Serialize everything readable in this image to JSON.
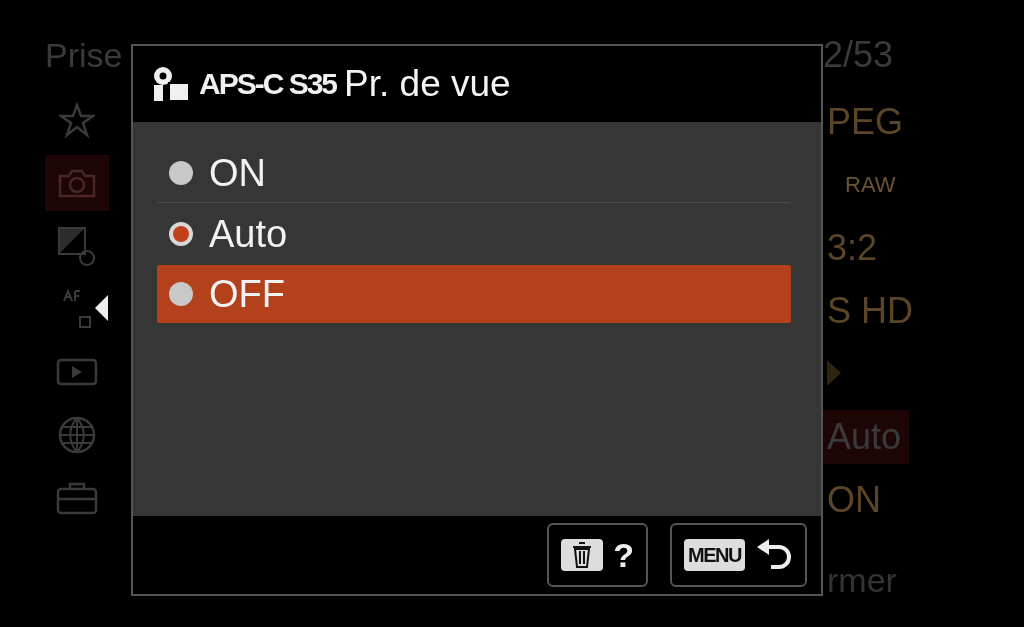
{
  "background_menu": {
    "title": "Prise",
    "page": "2/53",
    "tabs": [
      {
        "kind": "star",
        "selected": false
      },
      {
        "kind": "camera",
        "selected": true
      },
      {
        "kind": "exposure",
        "selected": false
      },
      {
        "kind": "af",
        "selected": false
      },
      {
        "kind": "play",
        "selected": false
      },
      {
        "kind": "globe",
        "selected": false
      },
      {
        "kind": "toolbox",
        "selected": false
      }
    ],
    "values": [
      {
        "kind": "text",
        "text": "PEG",
        "selected": false
      },
      {
        "kind": "small",
        "text": "RAW",
        "selected": false
      },
      {
        "kind": "text",
        "text": "3:2",
        "selected": false
      },
      {
        "kind": "text",
        "text": "S HD",
        "selected": false
      },
      {
        "kind": "arrow",
        "selected": false
      },
      {
        "kind": "text",
        "text": "Auto",
        "selected": true
      },
      {
        "kind": "text",
        "text": "ON",
        "selected": false
      }
    ],
    "footer": "rmer"
  },
  "dialog": {
    "badge": "APS-C S35",
    "title": "Pr. de vue",
    "options": [
      {
        "label": "ON",
        "checked": false,
        "selected": false
      },
      {
        "label": "Auto",
        "checked": true,
        "selected": false
      },
      {
        "label": "OFF",
        "checked": false,
        "selected": true
      }
    ],
    "buttons": [
      {
        "kind": "delete-help",
        "text": "?"
      },
      {
        "kind": "menu-back",
        "text": "MENU"
      }
    ]
  }
}
